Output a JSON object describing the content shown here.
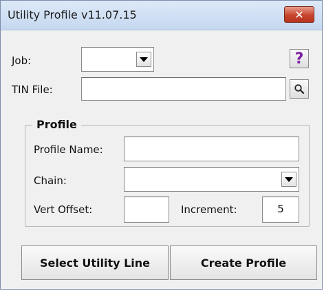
{
  "window": {
    "title": "Utility Profile v11.07.15",
    "close_icon": "close-icon",
    "close_glyph": "✕"
  },
  "job": {
    "label": "Job:",
    "value": ""
  },
  "tin_file": {
    "label": "TIN File:",
    "value": "",
    "browse_icon": "magnifier-icon"
  },
  "help": {
    "glyph": "?",
    "icon": "help-icon"
  },
  "profile_group": {
    "title": "Profile",
    "profile_name_label": "Profile Name:",
    "profile_name_value": "",
    "chain_label": "Chain:",
    "chain_value": "",
    "vert_offset_label": "Vert Offset:",
    "vert_offset_value": "",
    "increment_label": "Increment:",
    "increment_value": "5"
  },
  "buttons": {
    "select_utility_line": "Select Utility Line",
    "create_profile": "Create Profile"
  },
  "colors": {
    "window_bg": "#f0f0f0",
    "close_button": "#c7452e",
    "help_glyph": "#7a1fa3"
  }
}
